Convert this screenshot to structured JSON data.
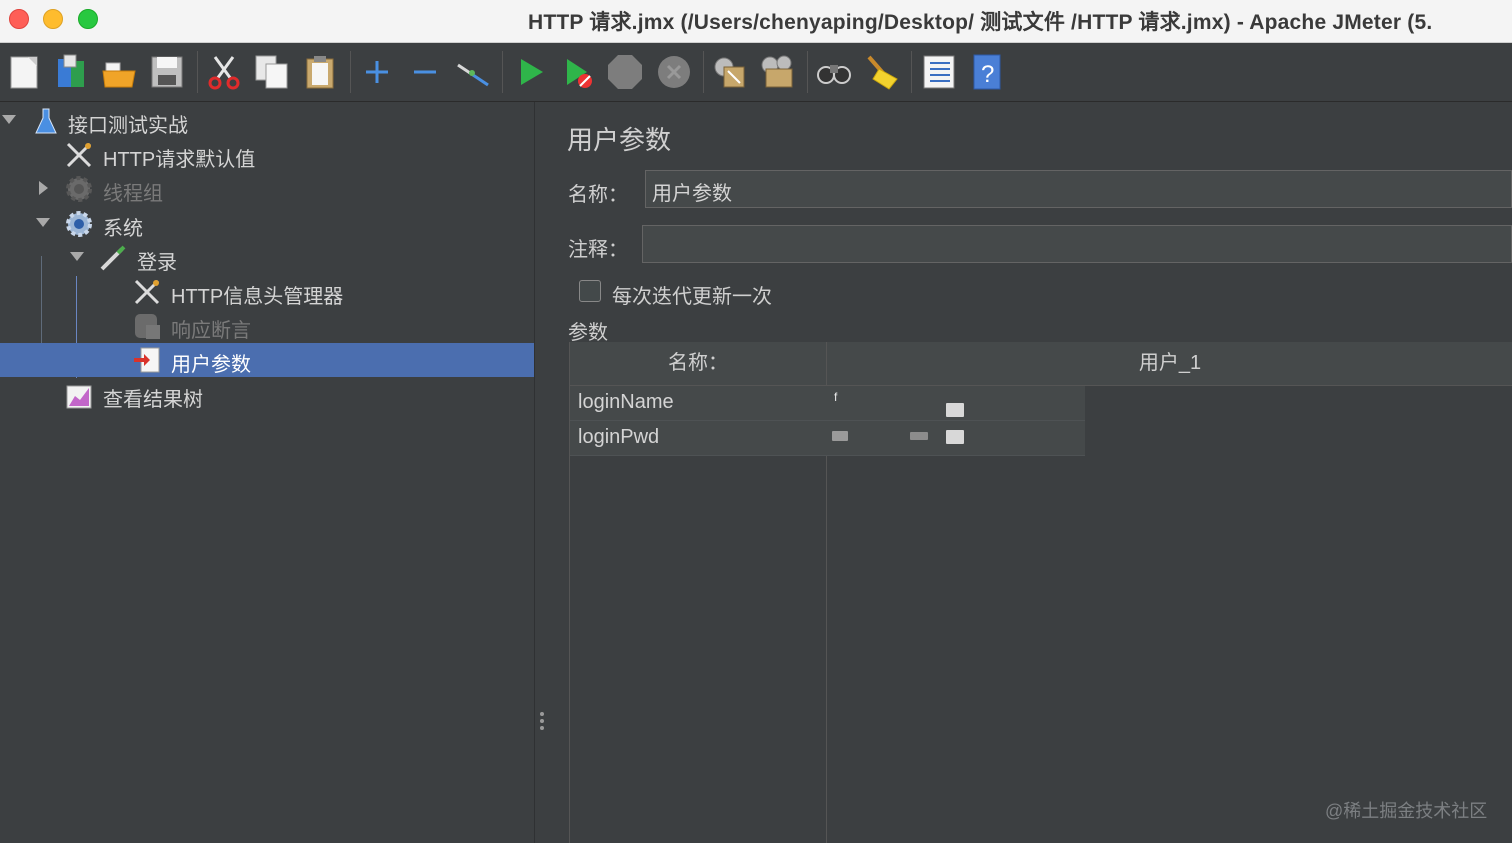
{
  "window": {
    "title": "HTTP 请求.jmx (/Users/chenyaping/Desktop/ 测试文件 /HTTP 请求.jmx) - Apache JMeter (5."
  },
  "toolbar": {
    "buttons": [
      {
        "name": "new-icon"
      },
      {
        "name": "templates-icon"
      },
      {
        "name": "open-icon"
      },
      {
        "name": "save-icon"
      },
      {
        "name": "cut-icon"
      },
      {
        "name": "copy-icon"
      },
      {
        "name": "paste-icon"
      },
      {
        "name": "expand-icon"
      },
      {
        "name": "collapse-icon"
      },
      {
        "name": "toggle-icon"
      },
      {
        "name": "start-icon"
      },
      {
        "name": "start-no-timers-icon"
      },
      {
        "name": "stop-icon"
      },
      {
        "name": "shutdown-icon"
      },
      {
        "name": "clear-icon"
      },
      {
        "name": "clear-all-icon"
      },
      {
        "name": "search-icon"
      },
      {
        "name": "reset-search-icon"
      },
      {
        "name": "function-helper-icon"
      },
      {
        "name": "help-icon"
      }
    ]
  },
  "tree": {
    "items": [
      {
        "label": "接口测试实战",
        "icon": "test-plan-icon",
        "expanded": true
      },
      {
        "label": "HTTP请求默认值",
        "icon": "config-tools-icon"
      },
      {
        "label": "线程组",
        "icon": "thread-group-icon",
        "disabled": true,
        "expanded": false
      },
      {
        "label": "系统",
        "icon": "thread-group-icon",
        "expanded": true
      },
      {
        "label": "登录",
        "icon": "sampler-pen-icon",
        "expanded": true
      },
      {
        "label": "HTTP信息头管理器",
        "icon": "config-tools-icon"
      },
      {
        "label": "响应断言",
        "icon": "assertion-icon",
        "disabled": true
      },
      {
        "label": "用户参数",
        "icon": "preprocessor-icon",
        "selected": true
      },
      {
        "label": "查看结果树",
        "icon": "listener-chart-icon"
      }
    ]
  },
  "panel": {
    "title": "用户参数",
    "name_label": "名称：",
    "name_value": "用户参数",
    "comment_label": "注释：",
    "comment_value": "",
    "checkbox_label": "每次迭代更新一次",
    "checkbox_checked": false,
    "params_label": "参数",
    "table": {
      "headers": [
        "名称：",
        "用户_1"
      ],
      "rows": [
        {
          "name": "loginName",
          "value": "f"
        },
        {
          "name": "loginPwd",
          "value": ""
        }
      ]
    }
  },
  "watermark": "@稀土掘金技术社区",
  "colors": {
    "background": "#3c3f41",
    "selection": "#4b6eaf",
    "title_bar": "#f4f4f4"
  }
}
